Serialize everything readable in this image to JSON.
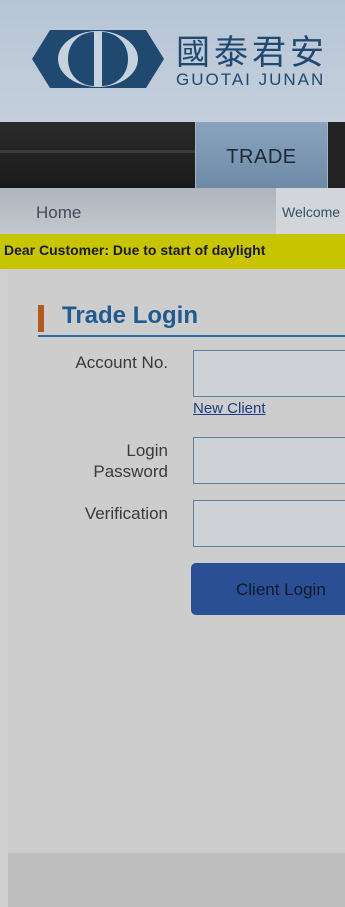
{
  "header": {
    "logo_cn": "國泰君安",
    "logo_en": "GUOTAI JUNAN"
  },
  "nav": {
    "tabs": [
      {
        "label": "TRADE"
      }
    ]
  },
  "breadcrumb": {
    "home": "Home",
    "welcome": "Welcome"
  },
  "notice": {
    "text": "Dear Customer: Due to start of daylight"
  },
  "login": {
    "title": "Trade Login",
    "account_label": "Account No.",
    "new_client_link": "New Client",
    "password_label_line1": "Login",
    "password_label_line2": "Password",
    "verification_label": "Verification",
    "submit_label": "Client Login"
  },
  "colors": {
    "brand_blue": "#1f4970",
    "notice_yellow": "#c7c400",
    "button_blue": "#2a4f94",
    "title_accent": "#b5581b"
  }
}
